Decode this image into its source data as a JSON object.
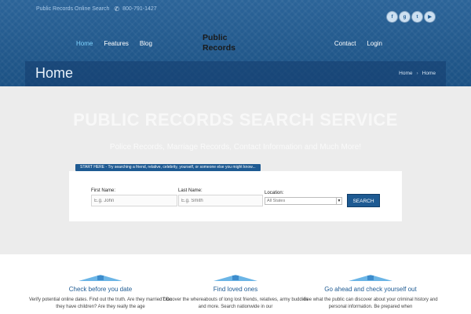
{
  "topbar": {
    "site_label": "Public Records Online Search",
    "phone": "800-791-1427",
    "phone_icon": "phone-icon"
  },
  "social": [
    {
      "name": "facebook-icon",
      "glyph": "f"
    },
    {
      "name": "google-plus-icon",
      "glyph": "g"
    },
    {
      "name": "twitter-icon",
      "glyph": "t"
    },
    {
      "name": "youtube-icon",
      "glyph": "▶"
    }
  ],
  "nav": {
    "left": [
      {
        "label": "Home",
        "active": true
      },
      {
        "label": "Features",
        "active": false
      },
      {
        "label": "Blog",
        "active": false
      }
    ],
    "logo_line1": "Public",
    "logo_line2": "Records",
    "right": [
      {
        "label": "Contact"
      },
      {
        "label": "Login"
      }
    ]
  },
  "page": {
    "title": "Home",
    "breadcrumb": [
      "Home",
      "Home"
    ]
  },
  "hero": {
    "title": "PUBLIC RECORDS SEARCH SERVICE",
    "subtitle": "Police Records, Marriage Records, Contact Information and Much More!",
    "start_tab": "START HERE - Try searching a friend, relative, celebrity, yourself, or someone else you might know..."
  },
  "search": {
    "first_name_label": "First Name:",
    "first_name_placeholder": "E.g. John",
    "last_name_label": "Last Name:",
    "last_name_placeholder": "E.g. Smith",
    "location_label": "Location:",
    "location_value": "All States",
    "button_label": "SEARCH"
  },
  "features": [
    {
      "title": "Check before you date",
      "text": "Verify potential online dates. Find out the truth. Are they married? Do they have children? Are they really the age"
    },
    {
      "title": "Find loved ones",
      "text": "Discover the whereabouts of long lost friends, relatives, army buddies and more. Search nationwide in our"
    },
    {
      "title": "Go ahead and check yourself out",
      "text": "See what the public can discover about your criminal history and personal information. Be prepared when"
    }
  ],
  "colors": {
    "brand_blue": "#1e5a92",
    "nav_active": "#7fd4ff",
    "feature_title": "#1e5a92"
  }
}
